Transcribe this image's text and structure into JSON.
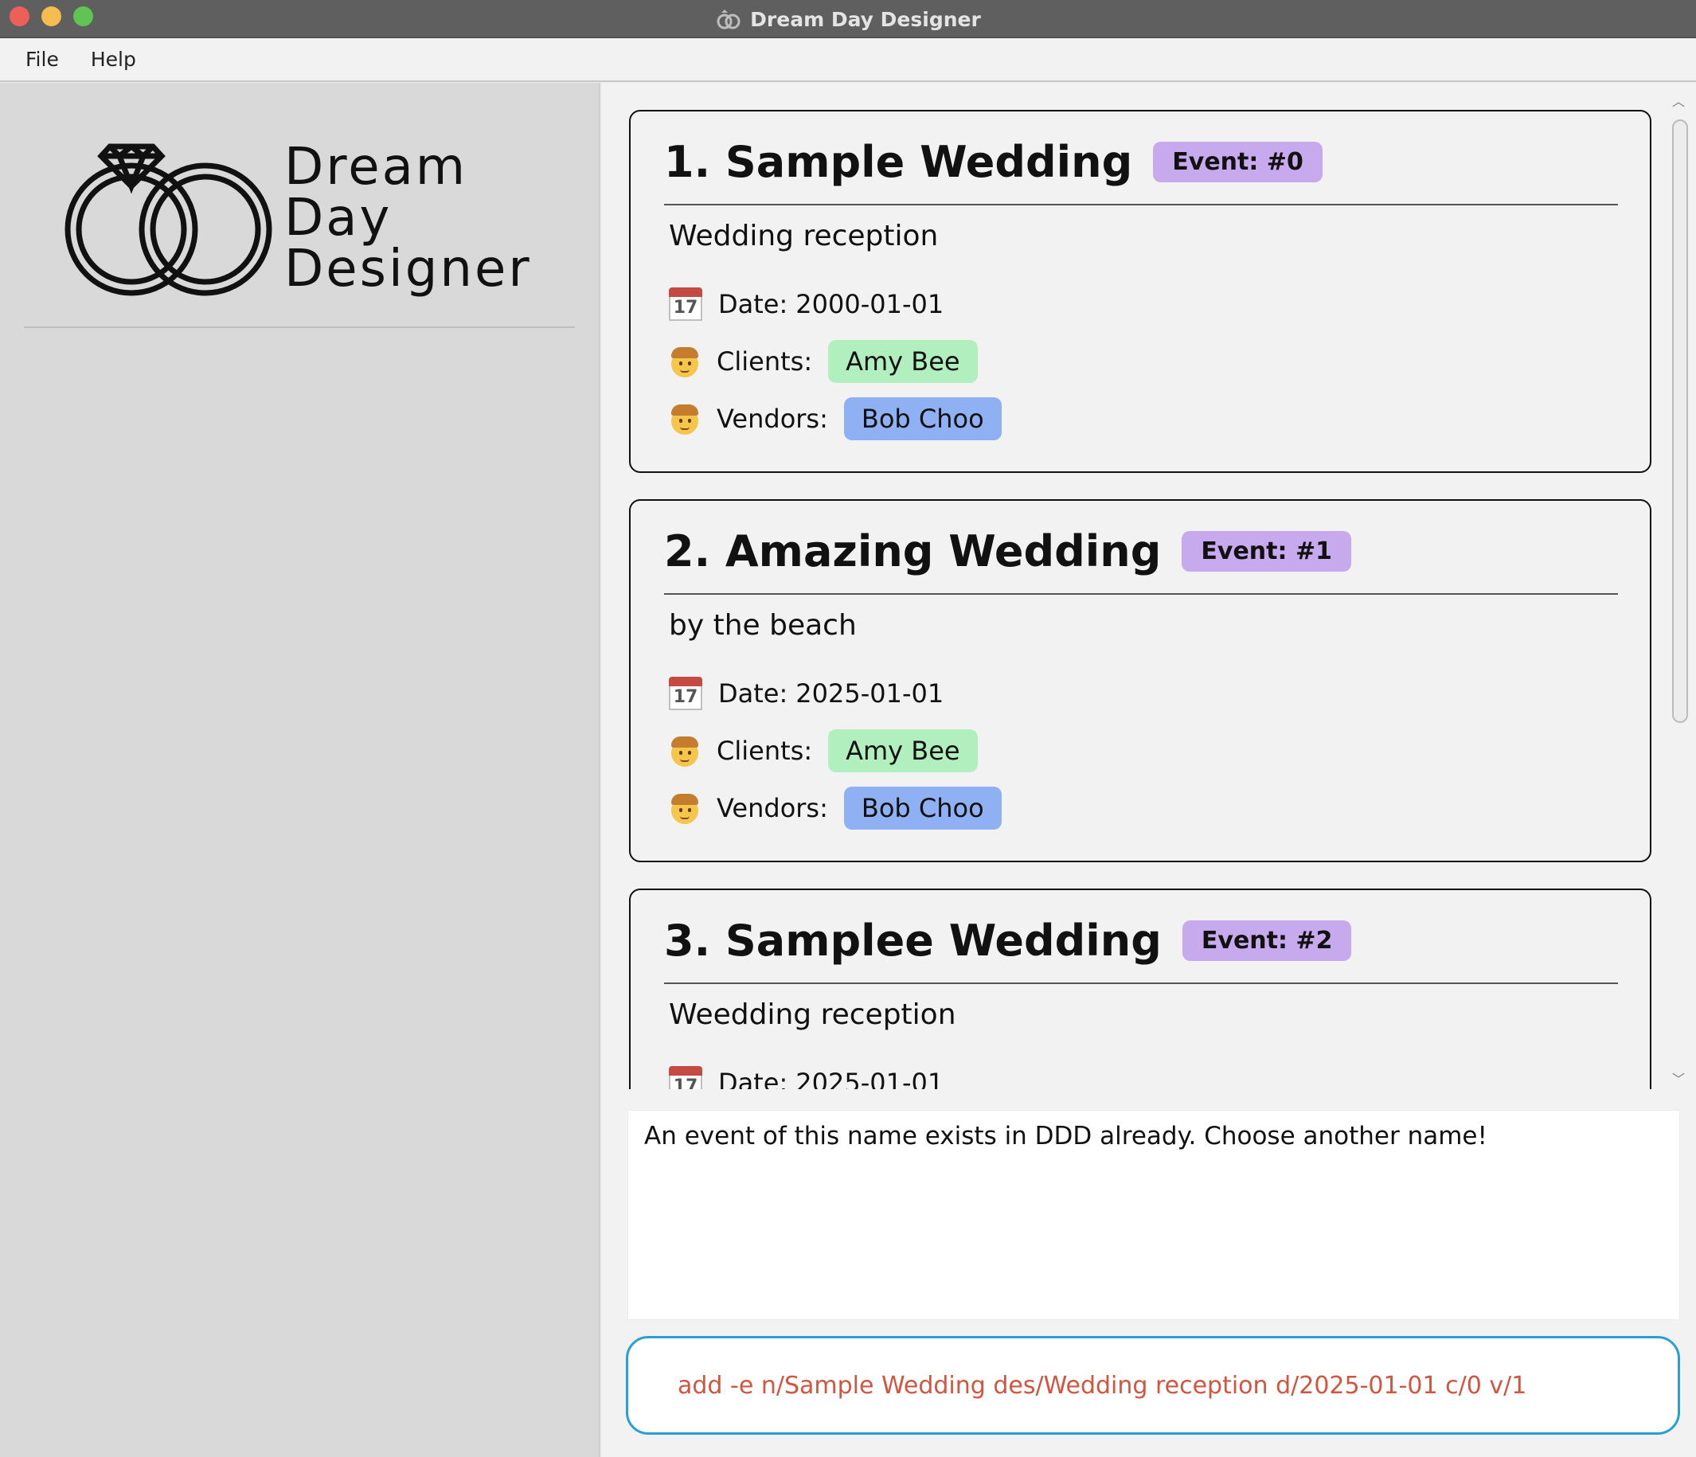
{
  "window": {
    "title": "Dream Day Designer"
  },
  "menu": {
    "items": [
      "File",
      "Help"
    ]
  },
  "sidebar": {
    "brand_lines": [
      "Dream",
      "Day",
      "Designer"
    ]
  },
  "events": [
    {
      "title": "1. Sample Wedding",
      "badge": "Event: #0",
      "description": "Wedding reception",
      "date_label": "Date:",
      "date": "2000-01-01",
      "clients_label": "Clients:",
      "client": "Amy Bee",
      "vendors_label": "Vendors:",
      "vendor": "Bob Choo"
    },
    {
      "title": "2. Amazing Wedding",
      "badge": "Event: #1",
      "description": "by the beach",
      "date_label": "Date:",
      "date": "2025-01-01",
      "clients_label": "Clients:",
      "client": "Amy Bee",
      "vendors_label": "Vendors:",
      "vendor": "Bob Choo"
    },
    {
      "title": "3. Samplee Wedding",
      "badge": "Event: #2",
      "description": "Weedding reception",
      "date_label": "Date:",
      "date": "2025-01-01"
    }
  ],
  "calendar_icon_text": "17",
  "result_message": "An event of this name exists in DDD already. Choose another name!",
  "command": {
    "value": "add -e n/Sample Wedding des/Wedding reception d/2025-01-01 c/0 v/1"
  },
  "colors": {
    "event_badge": "#c7a9ed",
    "client_chip": "#b2efbf",
    "vendor_chip": "#8fb1f4",
    "command_border": "#2a9fd6",
    "command_text": "#d2553f"
  }
}
